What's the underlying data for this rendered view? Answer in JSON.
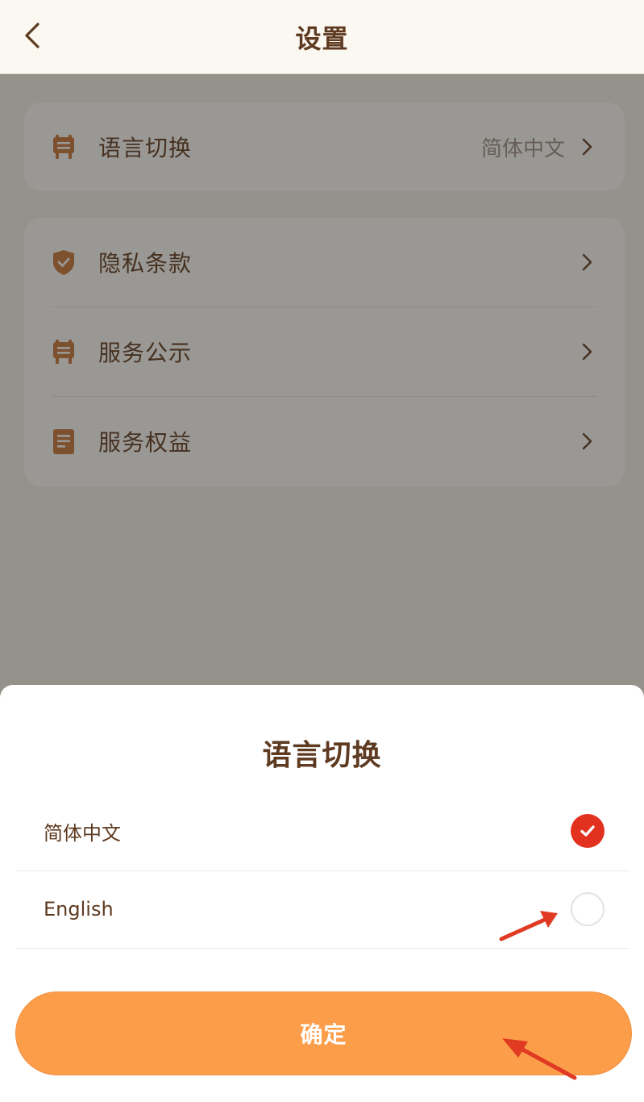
{
  "header": {
    "title": "设置",
    "back_icon": "chevron-left-icon"
  },
  "settings": {
    "language_row": {
      "label": "语言切换",
      "value": "简体中文",
      "icon": "signboard-icon"
    },
    "items": [
      {
        "label": "隐私条款",
        "icon": "shield-check-icon"
      },
      {
        "label": "服务公示",
        "icon": "signboard-icon"
      },
      {
        "label": "服务权益",
        "icon": "document-icon"
      }
    ]
  },
  "language_sheet": {
    "title": "语言切换",
    "options": [
      {
        "label": "简体中文",
        "selected": true
      },
      {
        "label": "English",
        "selected": false
      }
    ],
    "confirm_label": "确定"
  },
  "colors": {
    "brand_brown": "#5e3a20",
    "icon_orange": "#c8773a",
    "accent_orange": "#fc9d4a",
    "check_red": "#e2311f",
    "annotation_arrow": "#e03a22"
  }
}
